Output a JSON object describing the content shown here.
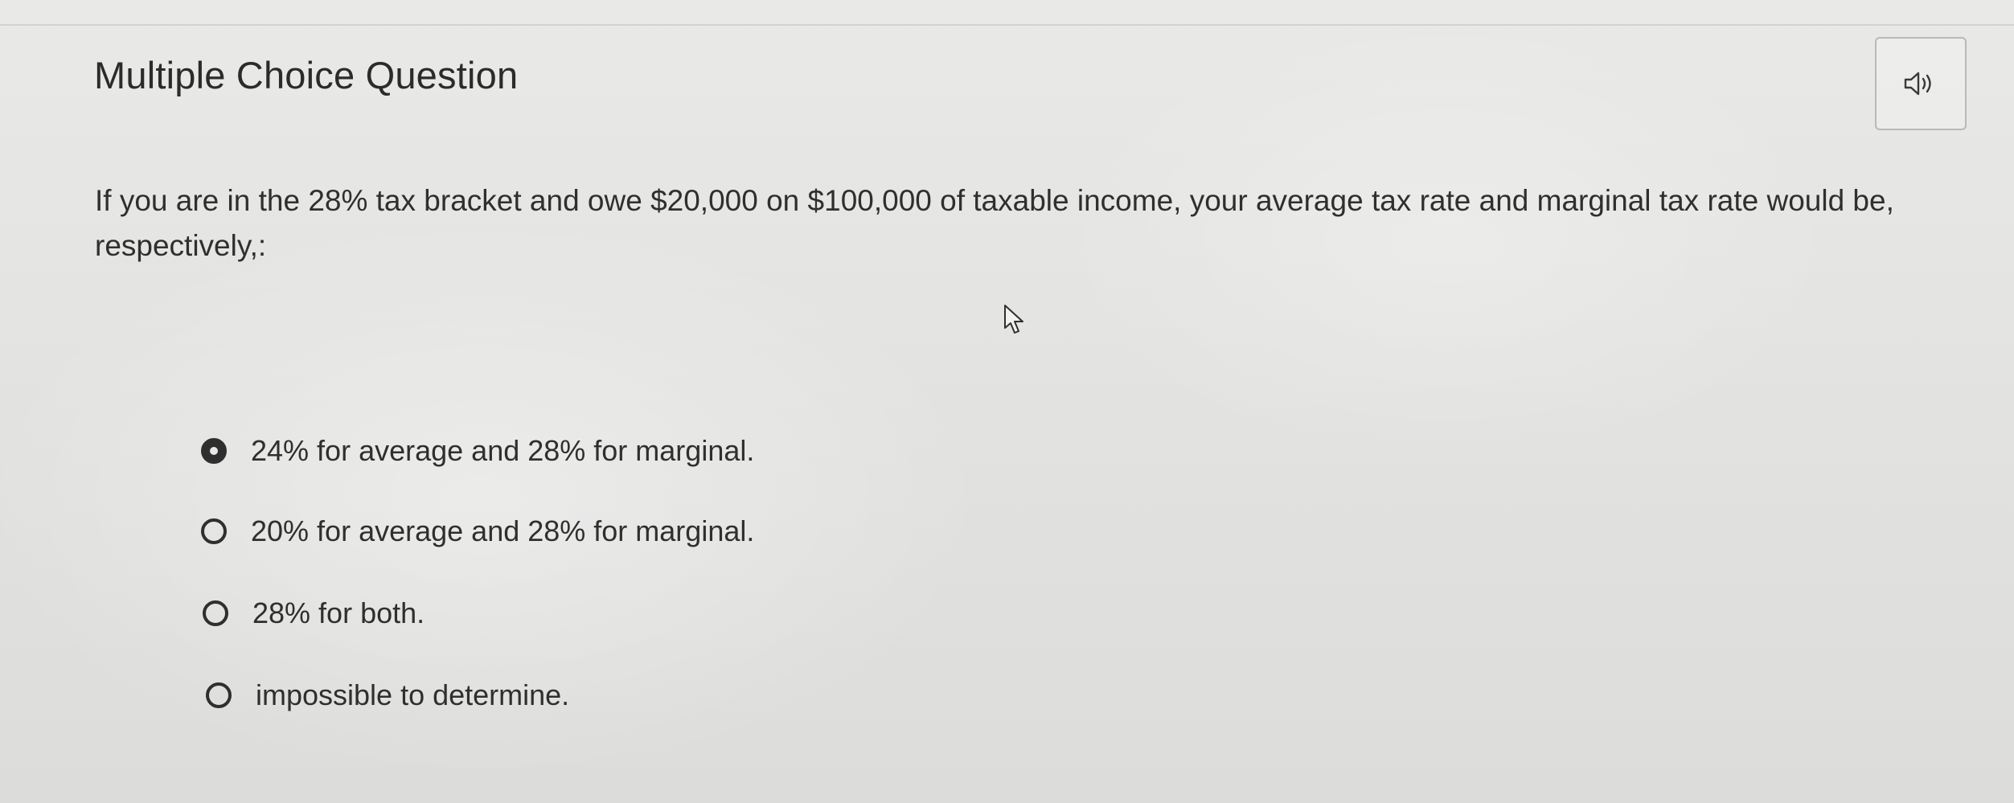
{
  "question": {
    "header": "Multiple Choice Question",
    "text": "If you are in the 28% tax bracket and owe $20,000 on $100,000 of taxable income, your average tax rate and marginal tax rate would be, respectively,:",
    "audio_icon": "speaker-icon"
  },
  "options": [
    {
      "label": "24% for average and 28% for marginal.",
      "selected": true
    },
    {
      "label": "20% for average and 28% for marginal.",
      "selected": false
    },
    {
      "label": "28% for both.",
      "selected": false
    },
    {
      "label": "impossible to determine.",
      "selected": false
    }
  ],
  "colors": {
    "text": "#2f2f2f",
    "background": "#e6e6e4",
    "border": "#b9b9b7"
  }
}
